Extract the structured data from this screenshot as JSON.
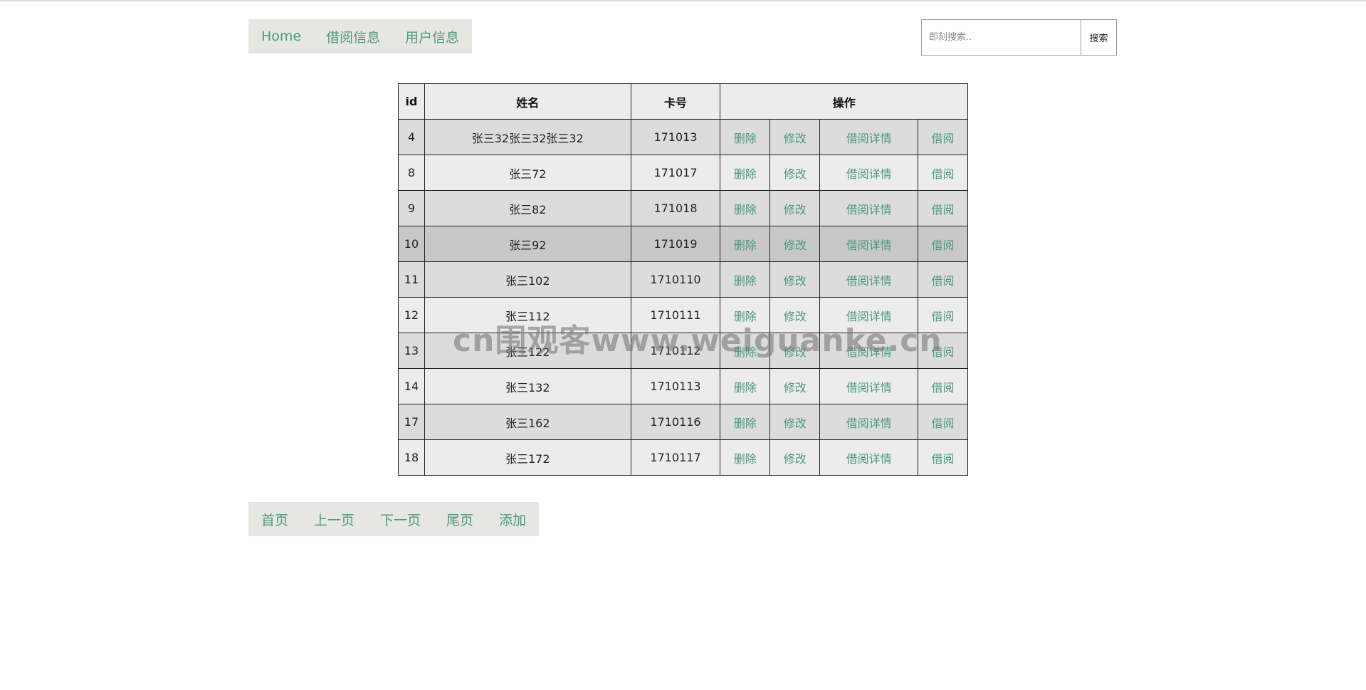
{
  "nav": {
    "items": [
      {
        "label": "Home"
      },
      {
        "label": "借阅信息"
      },
      {
        "label": "用户信息"
      }
    ]
  },
  "search": {
    "placeholder": "即刻搜索..",
    "button_label": "搜索"
  },
  "table": {
    "headers": {
      "id": "id",
      "name": "姓名",
      "card": "卡号",
      "actions": "操作"
    },
    "action_labels": {
      "delete": "删除",
      "edit": "修改",
      "details": "借阅详情",
      "borrow": "借阅"
    },
    "rows": [
      {
        "id": "4",
        "name": "张三32张三32张三32",
        "card": "171013"
      },
      {
        "id": "8",
        "name": "张三72",
        "card": "171017"
      },
      {
        "id": "9",
        "name": "张三82",
        "card": "171018"
      },
      {
        "id": "10",
        "name": "张三92",
        "card": "171019"
      },
      {
        "id": "11",
        "name": "张三102",
        "card": "1710110"
      },
      {
        "id": "12",
        "name": "张三112",
        "card": "1710111"
      },
      {
        "id": "13",
        "name": "张三122",
        "card": "1710112"
      },
      {
        "id": "14",
        "name": "张三132",
        "card": "1710113"
      },
      {
        "id": "17",
        "name": "张三162",
        "card": "1710116"
      },
      {
        "id": "18",
        "name": "张三172",
        "card": "1710117"
      }
    ]
  },
  "pager": {
    "first": "首页",
    "prev": "上一页",
    "next": "下一页",
    "last": "尾页",
    "add": "添加"
  },
  "watermark": "cn围观客www.weiguanke.cn",
  "colors": {
    "link": "#4b9a80",
    "nav_bg": "#e6e6e3",
    "row_odd": "#dcdcdc",
    "row_even": "#ececec",
    "row_hover": "#c8c8c8"
  }
}
